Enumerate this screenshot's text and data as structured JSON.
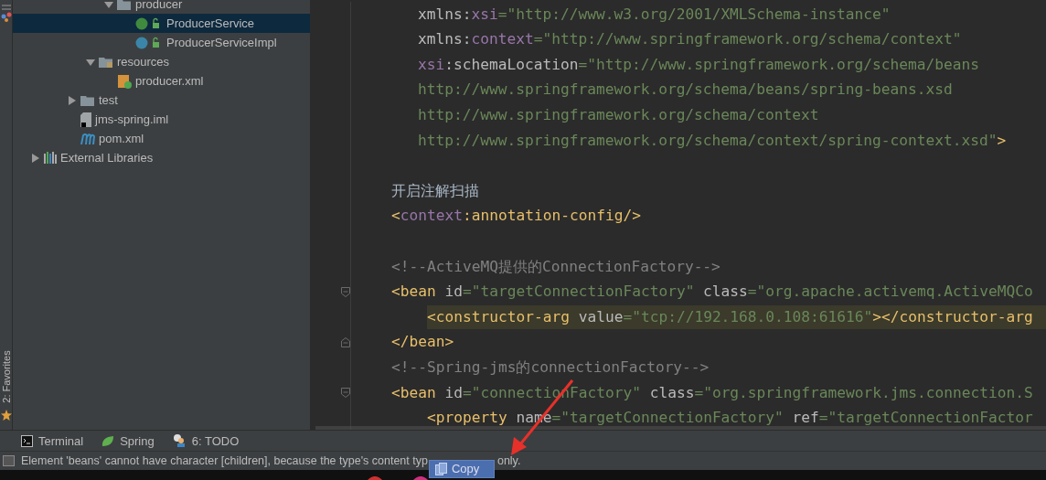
{
  "side_stripe": {
    "favorites_label": "2: Favorites"
  },
  "project_tree": {
    "branch": [
      {
        "label": "producer",
        "kind": "package",
        "expanded": true,
        "selected": false,
        "children": [
          {
            "label": "ProducerService",
            "kind": "interface",
            "selected": true
          },
          {
            "label": "ProducerServiceImpl",
            "kind": "class",
            "selected": false
          }
        ]
      }
    ],
    "main_items": [
      {
        "label": "resources",
        "kind": "resources",
        "expanded": true,
        "selected": false,
        "children": [
          {
            "label": "producer.xml",
            "kind": "spring-xml",
            "selected": false
          }
        ]
      }
    ],
    "module_items": [
      {
        "label": "test",
        "kind": "folder",
        "expanded": false,
        "selected": false
      },
      {
        "label": "jms-spring.iml",
        "kind": "iml",
        "selected": false
      },
      {
        "label": "pom.xml",
        "kind": "maven",
        "selected": false
      }
    ],
    "root_items": [
      {
        "label": "External Libraries",
        "kind": "libraries",
        "expanded": false,
        "selected": false
      }
    ]
  },
  "editor": {
    "lines": [
      {
        "kind": "attribute",
        "highlighted": false,
        "tokens": [
          {
            "kind": "attr",
            "text": "xmlns:"
          },
          {
            "kind": "ns",
            "text": "xsi"
          },
          {
            "kind": "value",
            "text": "=\"http://www.w3.org/2001/XMLSchema-instance\""
          }
        ]
      },
      {
        "kind": "attribute",
        "highlighted": false,
        "tokens": [
          {
            "kind": "attr",
            "text": "xmlns:"
          },
          {
            "kind": "ns",
            "text": "context"
          },
          {
            "kind": "value",
            "text": "=\"http://www.springframework.org/schema/context\""
          }
        ]
      },
      {
        "kind": "attribute",
        "highlighted": false,
        "tokens": [
          {
            "kind": "ns",
            "text": "xsi"
          },
          {
            "kind": "attr",
            "text": ":schemaLocation"
          },
          {
            "kind": "value",
            "text": "=\"http://www.springframework.org/schema/beans"
          }
        ]
      },
      {
        "kind": "attribute",
        "highlighted": false,
        "tokens": [
          {
            "kind": "value",
            "text": "http://www.springframework.org/schema/beans/spring-beans.xsd"
          }
        ]
      },
      {
        "kind": "attribute",
        "highlighted": false,
        "tokens": [
          {
            "kind": "value",
            "text": "http://www.springframework.org/schema/context"
          }
        ]
      },
      {
        "kind": "attribute",
        "highlighted": false,
        "tokens": [
          {
            "kind": "value",
            "text": "http://www.springframework.org/schema/context/spring-context.xsd\""
          },
          {
            "kind": "tag",
            "text": ">"
          }
        ]
      },
      {
        "kind": "blank"
      },
      {
        "kind": "code",
        "highlighted": false,
        "tokens": [
          {
            "kind": "plain",
            "text": "开启注解扫描"
          }
        ]
      },
      {
        "kind": "code",
        "highlighted": false,
        "tokens": [
          {
            "kind": "tag",
            "text": "<"
          },
          {
            "kind": "ns",
            "text": "context"
          },
          {
            "kind": "tag",
            "text": ":annotation-config/>"
          }
        ]
      },
      {
        "kind": "blank"
      },
      {
        "kind": "code",
        "highlighted": false,
        "tokens": [
          {
            "kind": "comment",
            "text": "<!--ActiveMQ提供的ConnectionFactory-->"
          }
        ]
      },
      {
        "kind": "code",
        "highlighted": false,
        "fold_open": true,
        "tokens": [
          {
            "kind": "tag",
            "text": "<bean"
          },
          {
            "kind": "attr",
            "text": " id"
          },
          {
            "kind": "value",
            "text": "=\"targetConnectionFactory\""
          },
          {
            "kind": "attr",
            "text": " class"
          },
          {
            "kind": "value",
            "text": "=\"org.apache.activemq.ActiveMQCo"
          }
        ]
      },
      {
        "kind": "nested",
        "highlighted": true,
        "tokens": [
          {
            "kind": "tag",
            "text": "<constructor-arg"
          },
          {
            "kind": "attr",
            "text": " value"
          },
          {
            "kind": "value",
            "text": "=\"tcp://192.168.0.108:61616\""
          },
          {
            "kind": "tag",
            "text": "></constructor-arg"
          }
        ]
      },
      {
        "kind": "code",
        "highlighted": false,
        "fold_close": true,
        "tokens": [
          {
            "kind": "tag",
            "text": "</bean>"
          }
        ]
      },
      {
        "kind": "code",
        "highlighted": false,
        "tokens": [
          {
            "kind": "comment",
            "text": "<!--Spring-jms的connectionFactory-->"
          }
        ]
      },
      {
        "kind": "code",
        "highlighted": false,
        "fold_open": true,
        "tokens": [
          {
            "kind": "tag",
            "text": "<bean"
          },
          {
            "kind": "attr",
            "text": " id"
          },
          {
            "kind": "value",
            "text": "=\"connectionFactory\""
          },
          {
            "kind": "attr",
            "text": " class"
          },
          {
            "kind": "value",
            "text": "=\"org.springframework.jms.connection.S"
          }
        ]
      },
      {
        "kind": "nested",
        "highlighted": false,
        "tokens": [
          {
            "kind": "tag",
            "text": "<property"
          },
          {
            "kind": "attr",
            "text": " name"
          },
          {
            "kind": "value",
            "text": "=\"targetConnectionFactory\""
          },
          {
            "kind": "attr",
            "text": " ref"
          },
          {
            "kind": "value",
            "text": "=\"targetConnectionFactor"
          }
        ]
      }
    ]
  },
  "tool_bar": [
    {
      "label": "Terminal",
      "kind": "terminal"
    },
    {
      "label": "Spring",
      "kind": "spring"
    },
    {
      "label": "6: TODO",
      "kind": "todo"
    }
  ],
  "status_bar": {
    "message_start": "Element 'beans' cannot have character [children], because the type's content typ",
    "message_end": "only."
  },
  "context_popup": {
    "label": "Copy"
  }
}
